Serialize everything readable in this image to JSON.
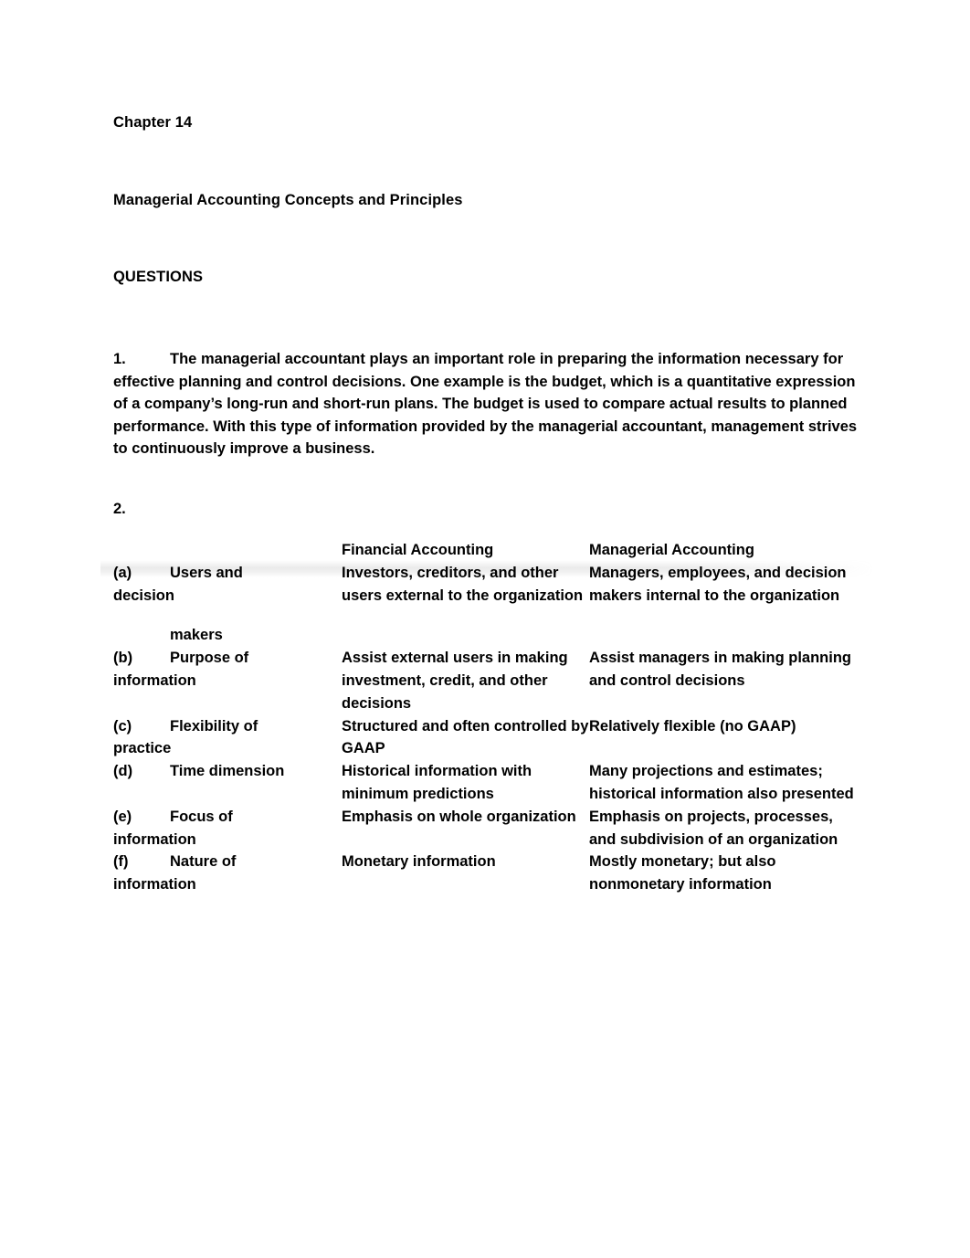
{
  "document": {
    "chapter": "Chapter 14",
    "title": "Managerial Accounting Concepts and Principles",
    "section_heading": "QUESTIONS"
  },
  "question_1": {
    "number": "1.",
    "text": "The managerial accountant plays an important role in preparing the information necessary for effective planning and control decisions.  One example is the budget, which is a quantitative expression of a company’s long-run and short-run plans.  The budget is used to compare actual results to planned performance.  With this type of information provided by the managerial accountant, management strives to continuously improve a business."
  },
  "question_2": {
    "number": "2.",
    "table": {
      "headers": {
        "label": "",
        "financial": "Financial Accounting",
        "managerial": "Managerial Accounting"
      },
      "rows": [
        {
          "key": "(a)",
          "label_part1": "Users and",
          "label_part2": "decision",
          "label_part3": "makers",
          "financial": "Investors, creditors, and other users external to the organization",
          "managerial": "Managers, employees, and decision makers internal to the organization"
        },
        {
          "key": "(b)",
          "label_part1": "Purpose of",
          "label_part2": "information",
          "financial": "Assist external users in making investment, credit, and other decisions",
          "managerial": "Assist managers in making planning and control decisions"
        },
        {
          "key": "(c)",
          "label_part1": "Flexibility of",
          "label_part2": "practice",
          "financial": "Structured and often controlled by GAAP",
          "managerial": "Relatively flexible (no GAAP)"
        },
        {
          "key": "(d)",
          "label_part1": "Time dimension",
          "label_part2": "",
          "financial": "Historical information with minimum predictions",
          "managerial": "Many projections and estimates; historical information also presented"
        },
        {
          "key": "(e)",
          "label_part1": "Focus of",
          "label_part2": "information",
          "financial": "Emphasis on whole organization",
          "managerial": "Emphasis on projects, processes, and subdivision of an organization"
        },
        {
          "key": "(f)",
          "label_part1": "Nature of",
          "label_part2": "information",
          "financial": "Monetary information",
          "managerial": "Mostly monetary; but also nonmonetary information"
        }
      ]
    }
  }
}
